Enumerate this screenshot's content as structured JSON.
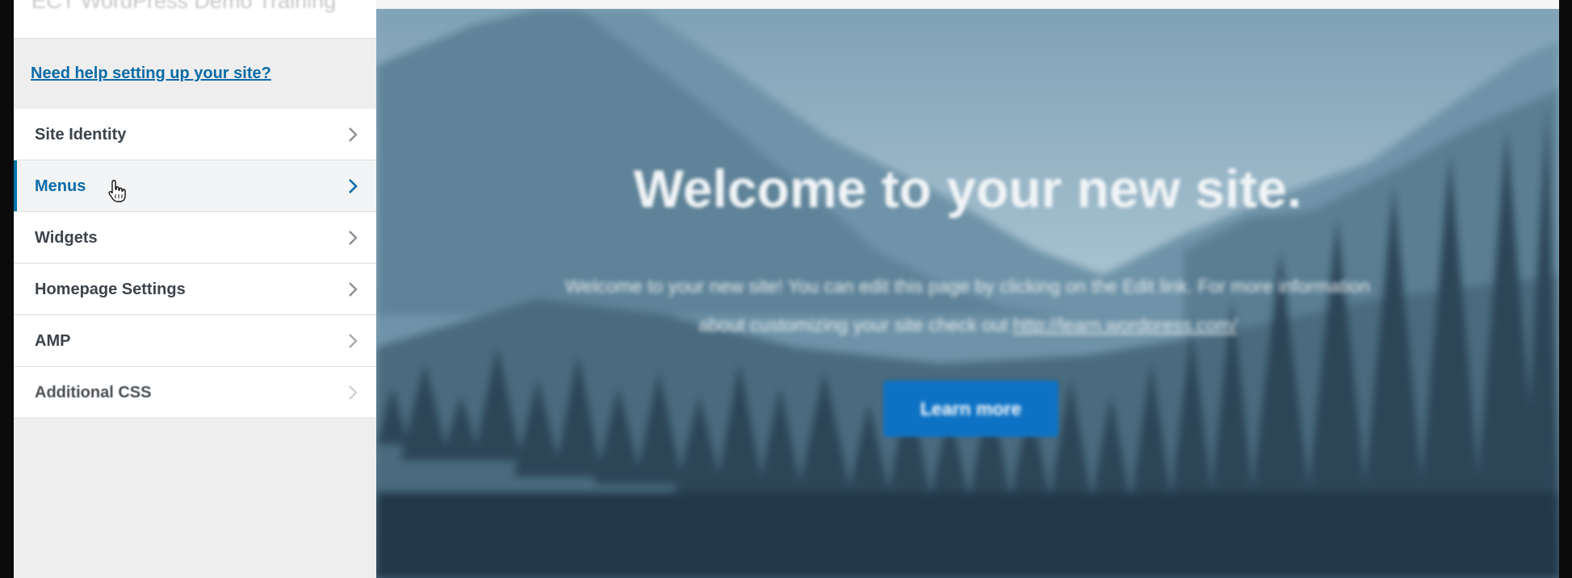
{
  "panel": {
    "site_title": "ECT WordPress Demo Training",
    "help_link": "Need help setting up your site?",
    "items": [
      {
        "label": "Site Identity",
        "active": false
      },
      {
        "label": "Menus",
        "active": true
      },
      {
        "label": "Widgets",
        "active": false
      },
      {
        "label": "Homepage Settings",
        "active": false
      },
      {
        "label": "AMP",
        "active": false
      },
      {
        "label": "Additional CSS",
        "active": false
      }
    ]
  },
  "preview": {
    "title": "Welcome to your new site.",
    "text_line1": "Welcome to your new site! You can edit this page by clicking on the Edit link. For more information",
    "text_line2_prefix": "about customizing your site check out ",
    "text_link": "http://learn.wordpress.com/",
    "button_label": "Learn more"
  },
  "colors": {
    "accent": "#0073aa",
    "link": "#0a6ba8",
    "button": "#0e72c4",
    "panel_bg": "#eeeeee"
  },
  "icons": {
    "chevron": "chevron-right-icon",
    "cursor": "hand-pointer-icon"
  }
}
